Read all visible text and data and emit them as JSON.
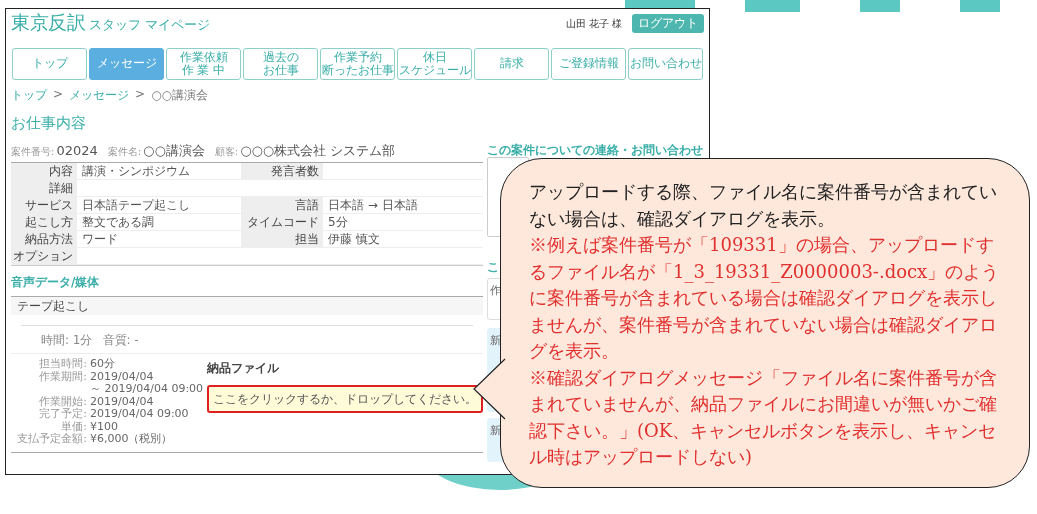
{
  "header": {
    "logo": "東京反訳",
    "subtitle": "スタッフ マイページ",
    "user": "山田 花子 様",
    "logout": "ログアウト"
  },
  "nav_tabs": [
    {
      "lines": [
        "トップ"
      ],
      "selected": false
    },
    {
      "lines": [
        "メッセージ"
      ],
      "selected": true
    },
    {
      "lines": [
        "作業依頼",
        "作 業 中"
      ],
      "selected": false
    },
    {
      "lines": [
        "過去の",
        "お仕事"
      ],
      "selected": false
    },
    {
      "lines": [
        "作業予約",
        "断ったお仕事"
      ],
      "selected": false
    },
    {
      "lines": [
        "休日",
        "スケジュール"
      ],
      "selected": false
    },
    {
      "lines": [
        "請求"
      ],
      "selected": false
    },
    {
      "lines": [
        "ご登録情報"
      ],
      "selected": false
    },
    {
      "lines": [
        "お問い合わせ"
      ],
      "selected": false
    }
  ],
  "breadcrumb": [
    {
      "kind": "link",
      "text": "トップ"
    },
    {
      "kind": "separator",
      "text": ">"
    },
    {
      "kind": "link",
      "text": "メッセージ"
    },
    {
      "kind": "separator",
      "text": ">"
    },
    {
      "kind": "current",
      "text": "○○講演会"
    }
  ],
  "page_title": "お仕事内容",
  "summary": [
    {
      "label": "案件番号:",
      "value": "02024"
    },
    {
      "label": "案件名:",
      "value": "○○講演会"
    },
    {
      "label": "顧客:",
      "value": "○○○株式会社 システム部"
    }
  ],
  "details": [
    {
      "cells": [
        {
          "label": "内容",
          "value": "講演・シンポジウム"
        },
        {
          "label": "発言者数"
        }
      ]
    },
    {
      "cells": [
        {
          "label": "詳細"
        }
      ]
    },
    {
      "cells": [
        {
          "label": "サービス",
          "value": "日本語テープ起こし"
        },
        {
          "label": "言語",
          "value": "日本語 → 日本語"
        }
      ]
    },
    {
      "cells": [
        {
          "label": "起こし方",
          "value": "整文である調"
        },
        {
          "label": "タイムコード",
          "value": "5分"
        }
      ]
    },
    {
      "cells": [
        {
          "label": "納品方法",
          "value": "ワード"
        },
        {
          "label": "担当",
          "value": "伊藤 慎文"
        }
      ]
    },
    {
      "cells": [
        {
          "label": "オプション"
        }
      ]
    }
  ],
  "media": {
    "heading": "音声データ/媒体",
    "item": "テープ起こし",
    "meta": [
      "時間: 1分",
      "音質: -"
    ]
  },
  "schedule": [
    {
      "label": "担当時間:",
      "value": "60分"
    },
    {
      "label": "作業期間:",
      "value": "2019/04/04"
    },
    {
      "value": "～ 2019/04/04 09:00"
    },
    {
      "label": "作業開始:",
      "value": "2019/04/04"
    },
    {
      "label": "完了予定:",
      "value": "2019/04/04 09:00"
    },
    {
      "label": "単価:",
      "value": "¥100"
    },
    {
      "label": "支払予定金額:",
      "value": "¥6,000（税別）"
    }
  ],
  "delivery": {
    "heading": "納品ファイル",
    "dropzone": "ここをクリックするか、ドロップしてください。"
  },
  "sidebar": {
    "contact_heading": "この案件についての連絡・お問い合わせ",
    "second_heading": "こ",
    "cards": [
      {
        "kind": "plain",
        "text": "作"
      },
      {
        "kind": "new",
        "text": "新"
      },
      {
        "kind": "new",
        "text": "新"
      }
    ]
  },
  "callout": {
    "paragraphs": [
      {
        "kind": "normal",
        "text": "アップロードする際、ファイル名に案件番号が含まれていない場合は、確認ダイアログを表示。"
      },
      {
        "kind": "note",
        "text": "※例えば案件番号が「109331」の場合、アップロードするファイル名が「1_3_19331_Z0000003-.docx」のように案件番号が含まれている場合は確認ダイアログを表示しませんが、案件番号が含まれていない場合は確認ダイアログを表示。"
      },
      {
        "kind": "note",
        "text": "※確認ダイアログメッセージ「ファイル名に案件番号が含まれていませんが、納品ファイルにお間違いが無いかご確認下さい。」(OK、キャンセルボタンを表示し、キャンセル時はアップロードしない)"
      }
    ]
  }
}
